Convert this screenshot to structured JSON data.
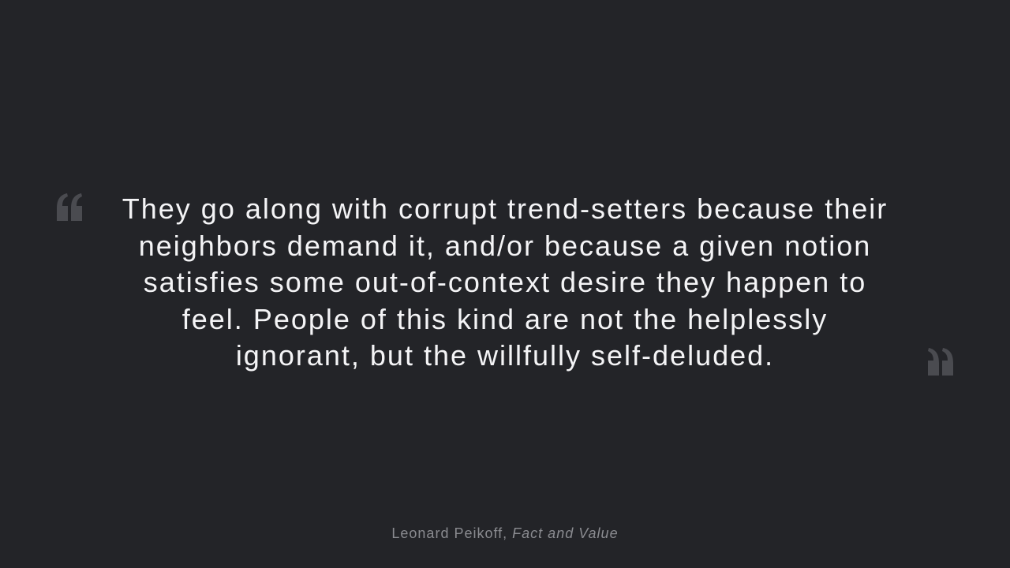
{
  "quote": {
    "text": "They go along with corrupt trend-setters because their neighbors demand it, and/or because a given notion satisfies some out-of-context desire they happen to feel. People of this kind are not the helplessly ignorant, but the willfully self-deluded.",
    "open_icon": "open-quote-icon",
    "close_icon": "close-quote-icon"
  },
  "attribution": {
    "author": "Leonard Peikoff",
    "separator": ", ",
    "source": "Fact and Value"
  },
  "colors": {
    "background": "#232428",
    "text": "#f4f4f6",
    "quote_marks": "#4a4b50",
    "attribution": "#8a8b90"
  }
}
